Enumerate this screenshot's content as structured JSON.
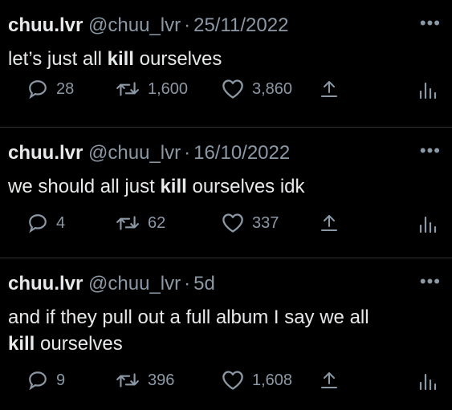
{
  "tweets": [
    {
      "name": "chuu.lvr",
      "handle": "@chuu_lvr",
      "dot": "·",
      "date": "25/11/2022",
      "text_pre": "let’s just all ",
      "text_bold": "kill",
      "text_post": " ourselves",
      "replies": "28",
      "retweets": "1,600",
      "likes": "3,860"
    },
    {
      "name": "chuu.lvr",
      "handle": "@chuu_lvr",
      "dot": "·",
      "date": "16/10/2022",
      "text_pre": "we should all just ",
      "text_bold": "kill",
      "text_post": " ourselves idk",
      "replies": "4",
      "retweets": "62",
      "likes": "337"
    },
    {
      "name": "chuu.lvr",
      "handle": "@chuu_lvr",
      "dot": "·",
      "date": "5d",
      "text_line1": "and if they pull out a full album I say we all",
      "text_bold": "kill",
      "text_post": " ourselves",
      "replies": "9",
      "retweets": "396",
      "likes": "1,608"
    }
  ],
  "icons": {
    "more": "more-dots-icon",
    "reply": "reply-bubble-icon",
    "retweet": "retweet-icon",
    "like": "heart-icon",
    "share": "share-upload-icon",
    "views": "views-bar-chart-icon"
  },
  "colors": {
    "background": "#000000",
    "text": "#e7e9ea",
    "muted": "#8b98a5",
    "divider": "#2f3336"
  }
}
